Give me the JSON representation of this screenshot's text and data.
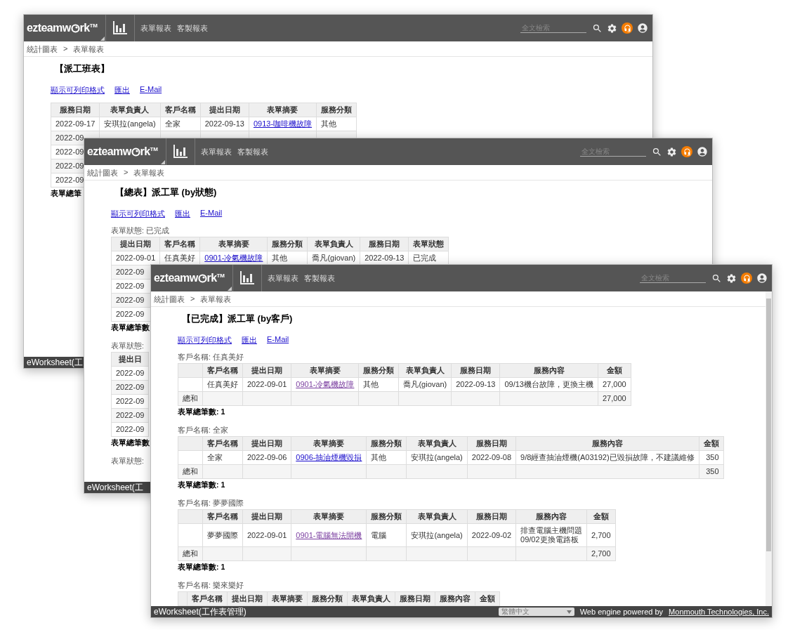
{
  "windows": [
    {
      "topbar": {
        "logo": {
          "before": "ezteamw",
          "after": "rk",
          "mark": "TM"
        },
        "nav": [
          "表單報表",
          "客製報表"
        ],
        "search": {
          "placeholder": "全文檢索"
        }
      },
      "breadcrumb": [
        "統計圖表",
        ">",
        "表單報表"
      ],
      "title": "【派工班表】",
      "links": [
        {
          "text": "顯示可列印格式",
          "visited": false
        },
        {
          "text": "匯出",
          "visited": false
        },
        {
          "text": "E-Mail",
          "visited": false
        }
      ],
      "sections": [
        {
          "kind": "table",
          "columns": [
            "服務日期",
            "表單負責人",
            "客戶名稱",
            "提出日期",
            "表單摘要",
            "服務分類"
          ],
          "rows": [
            {
              "cells": [
                "2022-09-17",
                "安琪拉(angela)",
                "全家",
                "2022-09-13",
                {
                  "text": "0913-咖啡機故障",
                  "visited": false
                },
                "其他"
              ]
            },
            {
              "cells": [
                "2022-09"
              ]
            },
            {
              "cells": [
                "2022-09"
              ]
            },
            {
              "cells": [
                "2022-09"
              ]
            },
            {
              "cells": [
                "2022-09"
              ]
            }
          ]
        },
        {
          "kind": "count",
          "text": "表單總筆"
        }
      ],
      "status_bar": {
        "text": "eWorksheet(工"
      }
    },
    {
      "topbar": {
        "logo": {
          "before": "ezteamw",
          "after": "rk",
          "mark": "TM"
        },
        "nav": [
          "表單報表",
          "客製報表"
        ],
        "search": {
          "placeholder": "全文檢索"
        }
      },
      "breadcrumb": [
        "統計圖表",
        ">",
        "表單報表"
      ],
      "title": "【總表】派工單 (by狀態)",
      "links": [
        {
          "text": "顯示可列印格式",
          "visited": false
        },
        {
          "text": "匯出",
          "visited": false
        },
        {
          "text": "E-Mail",
          "visited": false
        }
      ],
      "sections": [
        {
          "kind": "label",
          "text": "表單狀態: 已完成"
        },
        {
          "kind": "table",
          "columns": [
            "提出日期",
            "客戶名稱",
            "表單摘要",
            "服務分類",
            "表單負責人",
            "服務日期",
            "表單狀態"
          ],
          "rows": [
            {
              "cells": [
                "2022-09-01",
                "任真美好",
                {
                  "text": "0901-冷氣機故障",
                  "visited": false
                },
                "其他",
                "喬凡(giovan)",
                "2022-09-13",
                "已完成"
              ]
            },
            {
              "cells": [
                "2022-09"
              ]
            },
            {
              "cells": [
                "2022-09"
              ]
            },
            {
              "cells": [
                "2022-09"
              ]
            },
            {
              "cells": [
                "2022-09"
              ]
            }
          ]
        },
        {
          "kind": "count",
          "text": "表單總筆數"
        },
        {
          "kind": "label",
          "text": "表單狀態:"
        },
        {
          "kind": "table",
          "columns": [
            "提出日"
          ],
          "rows": [
            {
              "cells": [
                "2022-09"
              ]
            },
            {
              "cells": [
                "2022-09"
              ]
            },
            {
              "cells": [
                "2022-09"
              ]
            },
            {
              "cells": [
                "2022-09"
              ]
            },
            {
              "cells": [
                "2022-09"
              ]
            }
          ]
        },
        {
          "kind": "count",
          "text": "表單總筆數"
        },
        {
          "kind": "label",
          "text": "表單狀態:"
        }
      ],
      "status_bar": {
        "text": "eWorksheet(工"
      }
    },
    {
      "topbar": {
        "logo": {
          "before": "ezteamw",
          "after": "rk",
          "mark": "TM"
        },
        "nav": [
          "表單報表",
          "客製報表"
        ],
        "search": {
          "placeholder": "全文檢索"
        }
      },
      "breadcrumb": [
        "統計圖表",
        ">",
        "表單報表"
      ],
      "title": "【已完成】派工單 (by客戶)",
      "links": [
        {
          "text": "顯示可列印格式",
          "visited": false
        },
        {
          "text": "匯出",
          "visited": false
        },
        {
          "text": "E-Mail",
          "visited": false
        }
      ],
      "sections": [
        {
          "kind": "label",
          "text": "客戶名稱: 任真美好"
        },
        {
          "kind": "table",
          "lead_column": true,
          "columns": [
            "客戶名稱",
            "提出日期",
            "表單摘要",
            "服務分類",
            "表單負責人",
            "服務日期",
            "服務內容",
            "金額"
          ],
          "rows": [
            {
              "cells": [
                "任真美好",
                "2022-09-01",
                {
                  "text": "0901-冷氣機故障",
                  "visited": true
                },
                "其他",
                "喬凡(giovan)",
                "2022-09-13",
                "09/13機台故障，更換主機",
                "27,000"
              ]
            }
          ],
          "total": {
            "label": "總和",
            "amount": "27,000"
          }
        },
        {
          "kind": "count",
          "text": "表單總筆數: 1"
        },
        {
          "kind": "label",
          "text": "客戶名稱: 全家"
        },
        {
          "kind": "table",
          "lead_column": true,
          "columns": [
            "客戶名稱",
            "提出日期",
            "表單摘要",
            "服務分類",
            "表單負責人",
            "服務日期",
            "服務內容",
            "金額"
          ],
          "rows": [
            {
              "cells": [
                "全家",
                "2022-09-06",
                {
                  "text": "0906-抽油煙機毀損",
                  "visited": false
                },
                "其他",
                "安琪拉(angela)",
                "2022-09-08",
                "9/8經查抽油煙機(A03192)已毀損故障，不建議維修",
                "350"
              ]
            }
          ],
          "total": {
            "label": "總和",
            "amount": "350"
          }
        },
        {
          "kind": "count",
          "text": "表單總筆數: 1"
        },
        {
          "kind": "label",
          "text": "客戶名稱: 夢夢國際"
        },
        {
          "kind": "table",
          "lead_column": true,
          "columns": [
            "客戶名稱",
            "提出日期",
            "表單摘要",
            "服務分類",
            "表單負責人",
            "服務日期",
            "服務內容",
            "金額"
          ],
          "rows": [
            {
              "cells": [
                "夢夢國際",
                "2022-09-01",
                {
                  "text": "0901-電腦無法開機",
                  "visited": true
                },
                "電腦",
                "安琪拉(angela)",
                "2022-09-02",
                "排查電腦主機問題\n09/02更換電路板",
                "2,700"
              ]
            }
          ],
          "total": {
            "label": "總和",
            "amount": "2,700"
          }
        },
        {
          "kind": "count",
          "text": "表單總筆數: 1"
        },
        {
          "kind": "label",
          "text": "客戶名稱: 樂來樂好"
        },
        {
          "kind": "table",
          "lead_column": true,
          "columns": [
            "客戶名稱",
            "提出日期",
            "表單摘要",
            "服務分類",
            "表單負責人",
            "服務日期",
            "服務內容",
            "金額"
          ]
        }
      ],
      "status_bar": {
        "text": "eWorksheet(工作表管理)",
        "language": "繁體中文",
        "credit": "Web engine powered by",
        "credit_link": "Monmouth Technologies, Inc."
      }
    }
  ]
}
